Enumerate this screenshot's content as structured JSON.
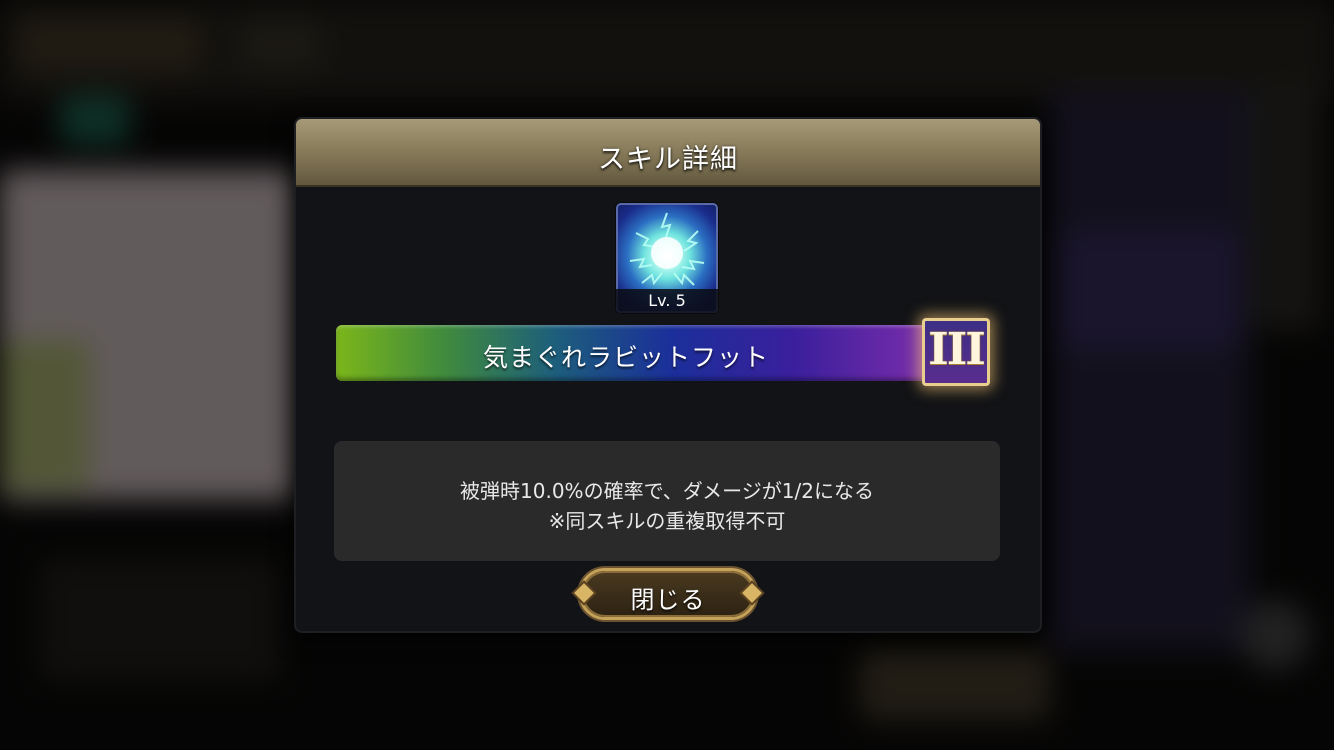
{
  "dialog": {
    "title": "スキル詳細",
    "close_label": "閉じる"
  },
  "skill": {
    "icon": "energy-orb-icon",
    "level_label": "Lv. 5",
    "name": "気まぐれラビットフット",
    "rank": "III",
    "description_line1": "被弾時10.0%の確率で、ダメージが1/2になる",
    "description_line2": "※同スキルの重複取得不可"
  },
  "colors": {
    "header_gold": "#8a7d5c",
    "panel_bg": "#121316",
    "desc_bg": "#2a2a2b",
    "bar_start": "#7bb61a",
    "bar_mid": "#1b2f9a",
    "bar_end": "#8a3aa0",
    "button_border": "#c5a25a"
  }
}
